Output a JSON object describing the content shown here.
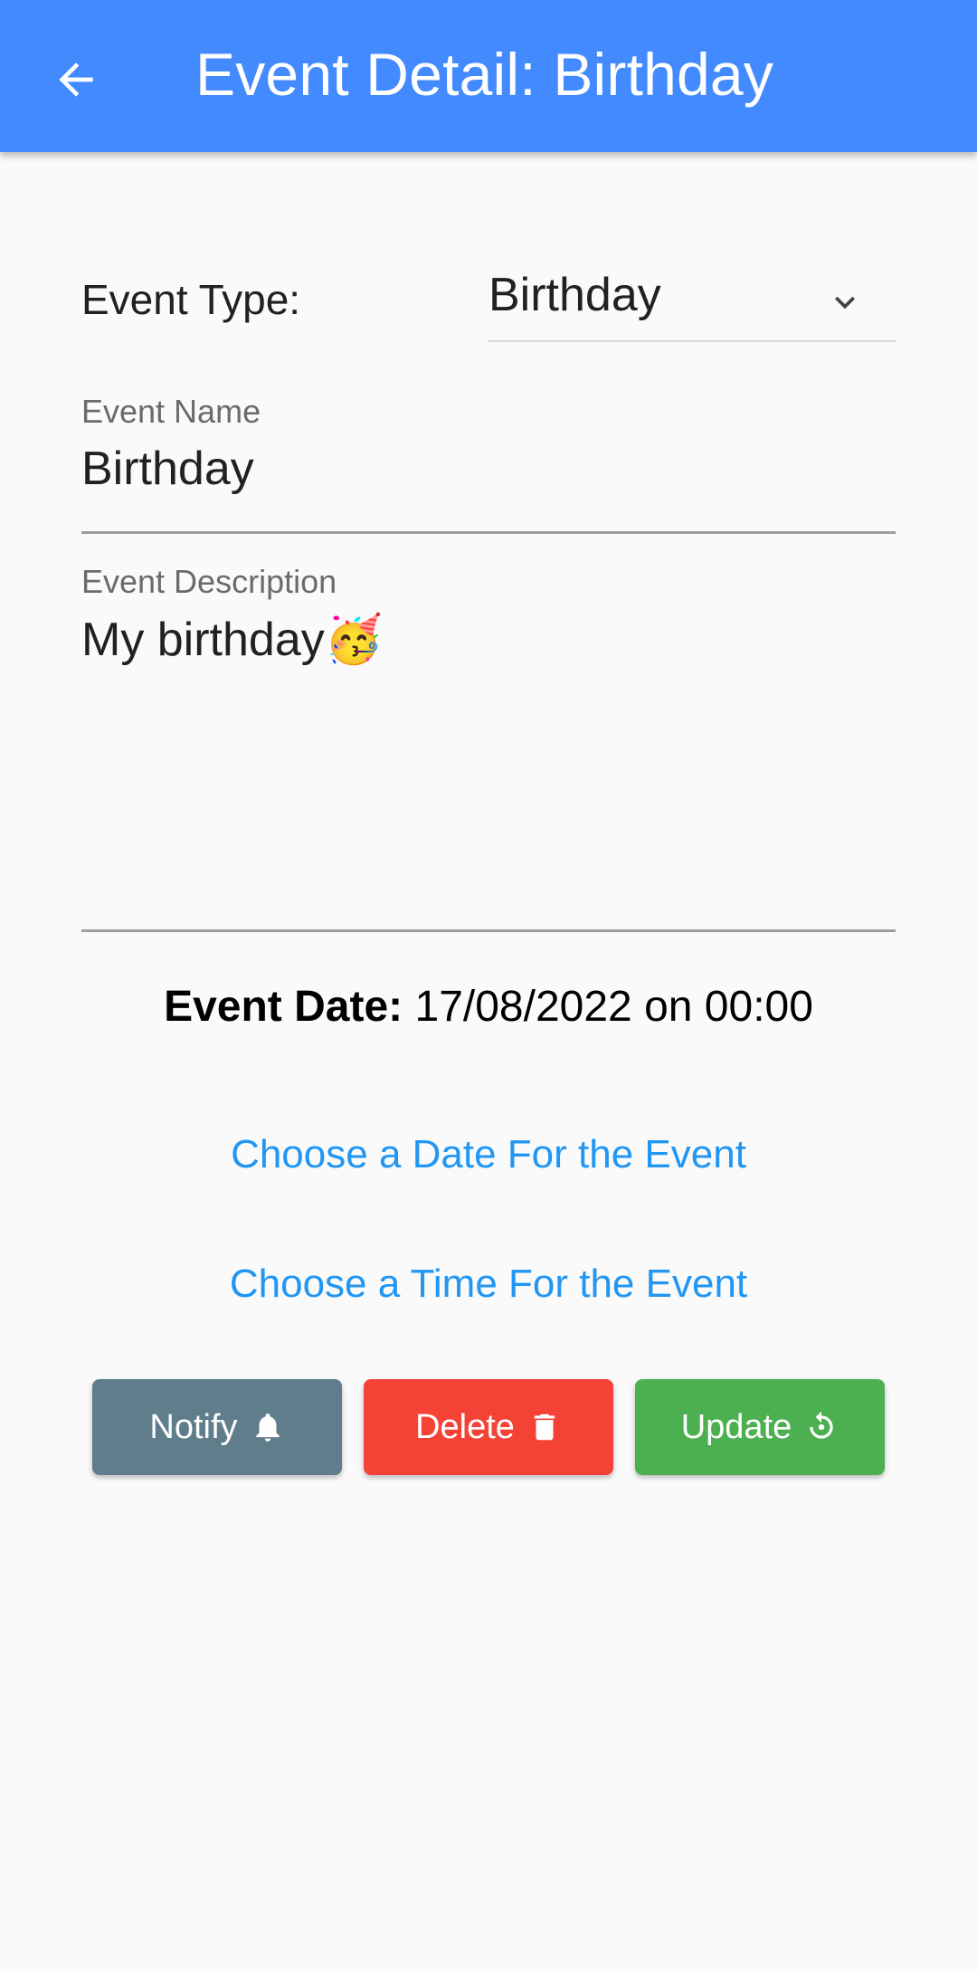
{
  "app_bar": {
    "title": "Event Detail: Birthday",
    "background_color": "#448aff",
    "back_icon": "arrow-back-icon"
  },
  "form": {
    "event_type": {
      "label": "Event Type:",
      "selected_value": "Birthday",
      "chevron_icon": "chevron-down-icon"
    },
    "event_name": {
      "label": "Event Name",
      "value": "Birthday"
    },
    "event_description": {
      "label": "Event Description",
      "value": "My birthday🥳"
    },
    "event_date": {
      "label": "Event Date:",
      "value": "17/08/2022 on 00:00"
    }
  },
  "links": {
    "choose_date": "Choose a Date For the Event",
    "choose_time": "Choose a Time For the Event",
    "color": "#2196f3"
  },
  "actions": {
    "notify": {
      "label": "Notify",
      "icon": "bell-icon",
      "color": "#607d8b"
    },
    "delete": {
      "label": "Delete",
      "icon": "trash-icon",
      "color": "#f44336"
    },
    "update": {
      "label": "Update",
      "icon": "refresh-icon",
      "color": "#4caf50"
    }
  }
}
